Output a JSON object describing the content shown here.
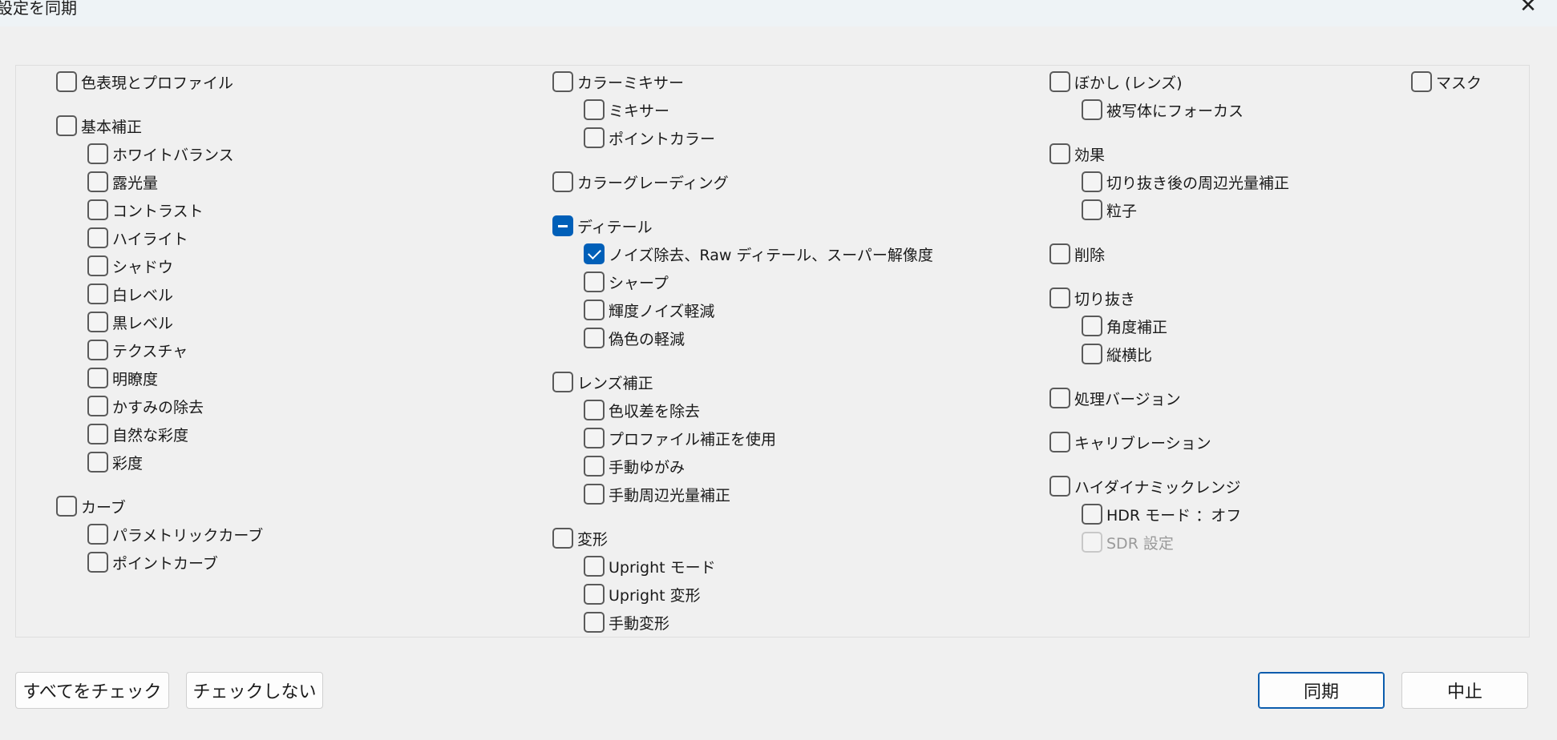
{
  "window": {
    "title": "設定を同期",
    "close_label": "✕"
  },
  "columns": {
    "c1": [
      {
        "label": "色表現とプロファイル",
        "state": "unchecked",
        "indent": 0
      },
      {
        "label": "基本補正",
        "state": "unchecked",
        "indent": 0
      },
      {
        "label": "ホワイトバランス",
        "state": "unchecked",
        "indent": 1
      },
      {
        "label": "露光量",
        "state": "unchecked",
        "indent": 1
      },
      {
        "label": "コントラスト",
        "state": "unchecked",
        "indent": 1
      },
      {
        "label": "ハイライト",
        "state": "unchecked",
        "indent": 1
      },
      {
        "label": "シャドウ",
        "state": "unchecked",
        "indent": 1
      },
      {
        "label": "白レベル",
        "state": "unchecked",
        "indent": 1
      },
      {
        "label": "黒レベル",
        "state": "unchecked",
        "indent": 1
      },
      {
        "label": "テクスチャ",
        "state": "unchecked",
        "indent": 1
      },
      {
        "label": "明瞭度",
        "state": "unchecked",
        "indent": 1
      },
      {
        "label": "かすみの除去",
        "state": "unchecked",
        "indent": 1
      },
      {
        "label": "自然な彩度",
        "state": "unchecked",
        "indent": 1
      },
      {
        "label": "彩度",
        "state": "unchecked",
        "indent": 1
      },
      {
        "label": "カーブ",
        "state": "unchecked",
        "indent": 0
      },
      {
        "label": "パラメトリックカーブ",
        "state": "unchecked",
        "indent": 1
      },
      {
        "label": "ポイントカーブ",
        "state": "unchecked",
        "indent": 1
      }
    ],
    "c2": [
      {
        "label": "カラーミキサー",
        "state": "unchecked",
        "indent": 0
      },
      {
        "label": "ミキサー",
        "state": "unchecked",
        "indent": 1
      },
      {
        "label": "ポイントカラー",
        "state": "unchecked",
        "indent": 1
      },
      {
        "label": "カラーグレーディング",
        "state": "unchecked",
        "indent": 0
      },
      {
        "label": "ディテール",
        "state": "mixed",
        "indent": 0
      },
      {
        "label": "ノイズ除去、Raw ディテール、スーパー解像度",
        "state": "checked",
        "indent": 1
      },
      {
        "label": "シャープ",
        "state": "unchecked",
        "indent": 1
      },
      {
        "label": "輝度ノイズ軽減",
        "state": "unchecked",
        "indent": 1
      },
      {
        "label": "偽色の軽減",
        "state": "unchecked",
        "indent": 1
      },
      {
        "label": "レンズ補正",
        "state": "unchecked",
        "indent": 0
      },
      {
        "label": "色収差を除去",
        "state": "unchecked",
        "indent": 1
      },
      {
        "label": "プロファイル補正を使用",
        "state": "unchecked",
        "indent": 1
      },
      {
        "label": "手動ゆがみ",
        "state": "unchecked",
        "indent": 1
      },
      {
        "label": "手動周辺光量補正",
        "state": "unchecked",
        "indent": 1
      },
      {
        "label": "変形",
        "state": "unchecked",
        "indent": 0
      },
      {
        "label": "Upright モード",
        "state": "unchecked",
        "indent": 1
      },
      {
        "label": "Upright 変形",
        "state": "unchecked",
        "indent": 1
      },
      {
        "label": "手動変形",
        "state": "unchecked",
        "indent": 1
      }
    ],
    "c3": [
      {
        "label": "ぼかし (レンズ)",
        "state": "unchecked",
        "indent": 0
      },
      {
        "label": "被写体にフォーカス",
        "state": "unchecked",
        "indent": 1
      },
      {
        "label": "効果",
        "state": "unchecked",
        "indent": 0
      },
      {
        "label": "切り抜き後の周辺光量補正",
        "state": "unchecked",
        "indent": 1
      },
      {
        "label": "粒子",
        "state": "unchecked",
        "indent": 1
      },
      {
        "label": "削除",
        "state": "unchecked",
        "indent": 0
      },
      {
        "label": "切り抜き",
        "state": "unchecked",
        "indent": 0
      },
      {
        "label": "角度補正",
        "state": "unchecked",
        "indent": 1
      },
      {
        "label": "縦横比",
        "state": "unchecked",
        "indent": 1
      },
      {
        "label": "処理バージョン",
        "state": "unchecked",
        "indent": 0
      },
      {
        "label": "キャリブレーション",
        "state": "unchecked",
        "indent": 0
      },
      {
        "label": "ハイダイナミックレンジ",
        "state": "unchecked",
        "indent": 0
      },
      {
        "label": "HDR モード ：オフ",
        "state": "unchecked",
        "indent": 1
      },
      {
        "label": "SDR 設定",
        "state": "disabled",
        "indent": 1
      }
    ],
    "c4": [
      {
        "label": "マスク",
        "state": "unchecked",
        "indent": 0
      }
    ]
  },
  "footer": {
    "check_all": "すべてをチェック",
    "check_none": "チェックしない",
    "sync": "同期",
    "cancel": "中止"
  },
  "colors": {
    "accent": "#005fb8",
    "background": "#f0f0f0"
  }
}
